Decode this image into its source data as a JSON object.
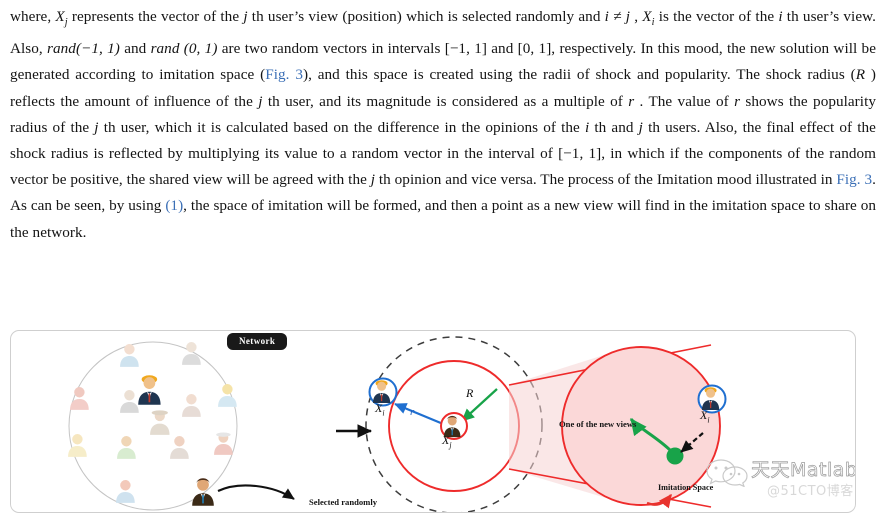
{
  "document": {
    "paragraph_runs": [
      {
        "t": "where, ",
        "s": "plain"
      },
      {
        "t": "X",
        "s": "math",
        "sub": "j"
      },
      {
        "t": " represents the vector of the ",
        "s": "plain"
      },
      {
        "t": "j",
        "s": "math"
      },
      {
        "t": " th user’s view (position) which is selected randomly and ",
        "s": "plain"
      },
      {
        "t": "i ≠ j",
        "s": "math"
      },
      {
        "t": " , ",
        "s": "plain"
      },
      {
        "t": "X",
        "s": "math",
        "sub": "i"
      },
      {
        "t": " is the vector of the ",
        "s": "plain"
      },
      {
        "t": "i",
        "s": "math"
      },
      {
        "t": " th user’s view. Also, ",
        "s": "plain"
      },
      {
        "t": "rand(−1, 1)",
        "s": "math"
      },
      {
        "t": " and ",
        "s": "plain"
      },
      {
        "t": "rand (0, 1)",
        "s": "math"
      },
      {
        "t": " are two random vectors in intervals [−1, 1] and [0, 1], respectively. In this mood, the new solution will be generated according to imitation space (",
        "s": "plain"
      },
      {
        "t": "Fig. 3",
        "s": "xref"
      },
      {
        "t": "), and this space is created using the radii of shock and popularity. The shock radius (",
        "s": "plain"
      },
      {
        "t": "R",
        "s": "math"
      },
      {
        "t": " ) reflects the amount of influence of the ",
        "s": "plain"
      },
      {
        "t": "j",
        "s": "math"
      },
      {
        "t": " th user, and its magnitude is considered as a multiple of ",
        "s": "plain"
      },
      {
        "t": "r",
        "s": "math"
      },
      {
        "t": " . The value of ",
        "s": "plain"
      },
      {
        "t": "r",
        "s": "math"
      },
      {
        "t": " shows the popularity radius of the ",
        "s": "plain"
      },
      {
        "t": "j",
        "s": "math"
      },
      {
        "t": " th user, which it is calculated based on the difference in the opinions of the ",
        "s": "plain"
      },
      {
        "t": "i",
        "s": "math"
      },
      {
        "t": " th and ",
        "s": "plain"
      },
      {
        "t": "j",
        "s": "math"
      },
      {
        "t": " th users. Also, the final effect of the shock radius is reflected by multiplying its value to a random vector in the interval of [−1, 1], in which if the components of the random vector be positive, the shared view will be agreed with the ",
        "s": "plain"
      },
      {
        "t": "j",
        "s": "math"
      },
      {
        "t": " th opinion and vice versa. The process of the Imitation mood illustrated in ",
        "s": "plain"
      },
      {
        "t": "Fig. 3",
        "s": "xref"
      },
      {
        "t": ". As can be seen, by using ",
        "s": "plain"
      },
      {
        "t": "(1)",
        "s": "xref"
      },
      {
        "t": ", the space of imitation will be formed, and then a point as a new view will find in the imitation space to share on the network.",
        "s": "plain"
      }
    ]
  },
  "figure": {
    "network_chip_label": "Network",
    "selected_randomly_label": "Selected randomly",
    "new_views_label": "One of the new views",
    "imitation_space_label": "Imitation Space",
    "label_xi_left": "X",
    "label_xi_left_sub": "i",
    "label_xj": "X",
    "label_xj_sub": "j",
    "label_xi_right": "X",
    "label_xi_right_sub": "i",
    "label_r": "r",
    "label_R": "R",
    "colors": {
      "red_stroke": "#ee2b2b",
      "imitation_fill": "#fbd8d8",
      "blue_arrow": "#1f6fd0",
      "green_arrow": "#18a349",
      "green_dot": "#18a349",
      "dashed_gray": "#4a4a4a",
      "chip_bg": "#191919",
      "panel_border": "#cfcfcf",
      "network_circle": "#bdbdbd"
    }
  },
  "watermark": {
    "main_text": "天天Matlab",
    "sub_text": "@51CTO博客"
  }
}
